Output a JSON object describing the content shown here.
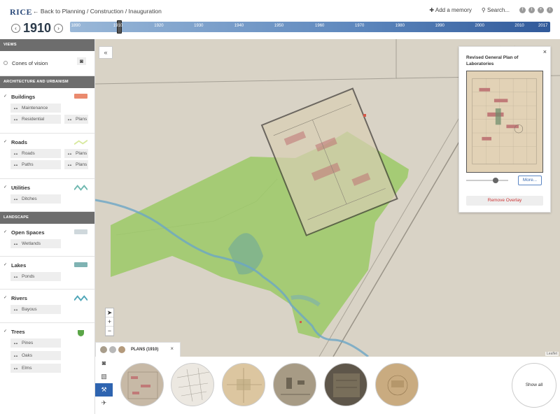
{
  "header": {
    "logo": "RICE",
    "breadcrumb": "← Back to Planning / Construction / Inauguration",
    "add_memory": "Add a memory",
    "search": "Search...",
    "social": [
      "f",
      "t",
      "+",
      "i"
    ]
  },
  "year": {
    "value": "1910",
    "prev_icon": "chevron-left-icon",
    "next_icon": "chevron-right-icon"
  },
  "timeline": {
    "ticks": [
      "1890",
      "1910",
      "1920",
      "1930",
      "1940",
      "1950",
      "1960",
      "1970",
      "1980",
      "1990",
      "2000",
      "2010",
      "2017"
    ],
    "range": [
      1890,
      2017
    ],
    "selected": 1910
  },
  "sidebar": {
    "views_header": "VIEWS",
    "cones_label": "Cones of vision",
    "arch_header": "ARCHITECTURE AND URBANISM",
    "buildings": {
      "label": "Buildings",
      "subs": [
        "Maintenance",
        "Residential",
        "Plans"
      ],
      "color": "#ea8a6e"
    },
    "roads": {
      "label": "Roads",
      "subs": [
        "Roads",
        "Plans",
        "Paths",
        "Plans"
      ],
      "color": "#d8e9a0"
    },
    "utilities": {
      "label": "Utilities",
      "subs": [
        "Ditches"
      ],
      "color": "#6fb8b0"
    },
    "landscape_header": "LANDSCAPE",
    "open_spaces": {
      "label": "Open Spaces",
      "subs": [
        "Wetlands"
      ],
      "color": "#cfd8dc"
    },
    "lakes": {
      "label": "Lakes",
      "subs": [
        "Ponds"
      ],
      "color": "#7fb3b3"
    },
    "rivers": {
      "label": "Rivers",
      "subs": [
        "Bayous"
      ],
      "color": "#4fa6b8"
    },
    "trees": {
      "label": "Trees",
      "subs": [
        "Pines",
        "Oaks",
        "Elms"
      ],
      "color": "#5aa547"
    }
  },
  "overlay_card": {
    "title": "Revised General Plan of Laboratories",
    "more_label": "More...",
    "remove_label": "Remove Overlay",
    "opacity": 0.7
  },
  "bottom": {
    "plans_label": "PLANS (1910)",
    "show_all": "Show all",
    "leaflet": "Leaflet"
  },
  "map_controls": {
    "zoom_in": "+",
    "zoom_out": "−",
    "collapse": "«"
  }
}
